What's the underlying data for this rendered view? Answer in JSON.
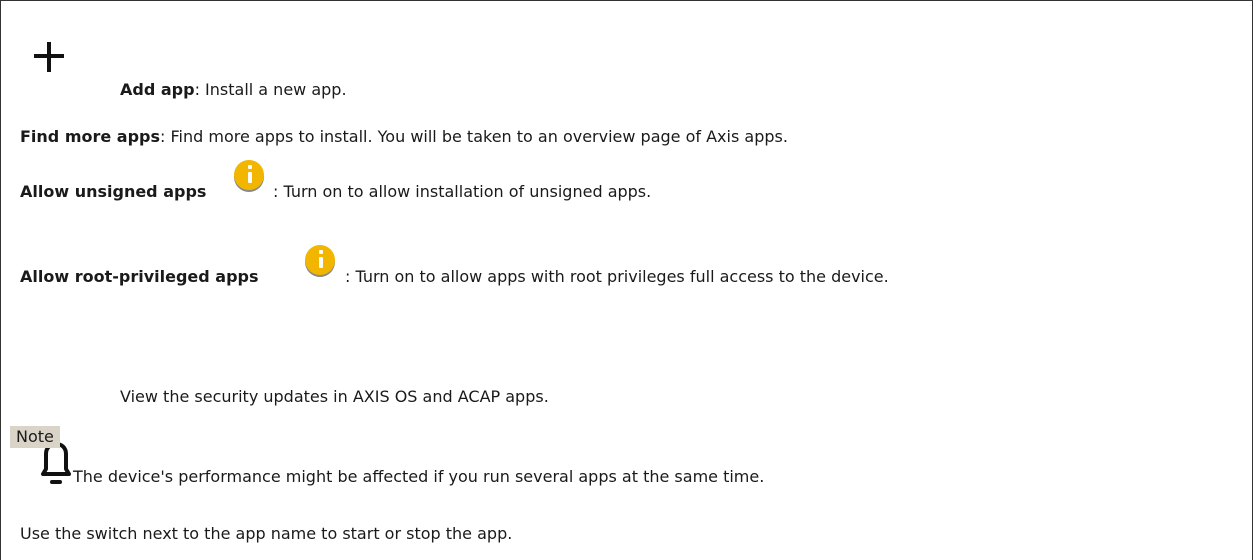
{
  "add_app": {
    "label": "Add app",
    "desc": ": Install a new app."
  },
  "find_more": {
    "label": "Find more apps",
    "desc": ": Find more apps to install. You will be taken to an overview page of Axis apps."
  },
  "allow_unsigned": {
    "label": "Allow unsigned apps",
    "desc": ": Turn on to allow installation of unsigned apps."
  },
  "allow_root": {
    "label": "Allow root-privileged apps",
    "desc": ": Turn on to allow apps with root privileges full access to the device."
  },
  "security": {
    "text": "View the security updates in AXIS OS and ACAP apps."
  },
  "note": {
    "label": "Note",
    "text": "The device's performance might be affected if you run several apps at the same time."
  },
  "footer": {
    "text": "Use the switch next to the app name to start or stop the app."
  },
  "colors": {
    "info_icon": "#f2b600",
    "note_bg": "#d9d3c8"
  }
}
